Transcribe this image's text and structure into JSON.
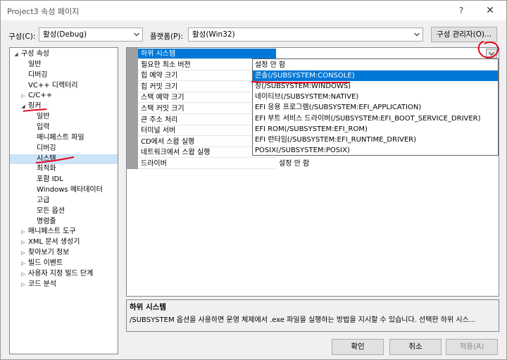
{
  "window": {
    "title": "Project3 속성 페이지",
    "help_glyph": "?",
    "close_glyph": "✕"
  },
  "config": {
    "label": "구성(C):",
    "value": "활성(Debug)"
  },
  "platform": {
    "label": "플랫폼(P):",
    "value": "활성(Win32)"
  },
  "config_manager_label": "구성 관리자(O)...",
  "tree": {
    "items": [
      {
        "label": "구성 속성",
        "level": 0,
        "expander": "◢"
      },
      {
        "label": "일반",
        "level": 1,
        "expander": ""
      },
      {
        "label": "디버깅",
        "level": 1,
        "expander": ""
      },
      {
        "label": "VC++ 디렉터리",
        "level": 1,
        "expander": ""
      },
      {
        "label": "C/C++",
        "level": 1,
        "expander": "▷"
      },
      {
        "label": "링커",
        "level": 1,
        "expander": "◢"
      },
      {
        "label": "일반",
        "level": 2,
        "expander": ""
      },
      {
        "label": "입력",
        "level": 2,
        "expander": ""
      },
      {
        "label": "매니페스트 파일",
        "level": 2,
        "expander": ""
      },
      {
        "label": "디버깅",
        "level": 2,
        "expander": ""
      },
      {
        "label": "시스템",
        "level": 2,
        "expander": "",
        "selected": true
      },
      {
        "label": "최적화",
        "level": 2,
        "expander": ""
      },
      {
        "label": "포함 IDL",
        "level": 2,
        "expander": ""
      },
      {
        "label": "Windows 메타데이터",
        "level": 2,
        "expander": ""
      },
      {
        "label": "고급",
        "level": 2,
        "expander": ""
      },
      {
        "label": "모든 옵션",
        "level": 2,
        "expander": ""
      },
      {
        "label": "명령줄",
        "level": 2,
        "expander": ""
      },
      {
        "label": "매니페스트 도구",
        "level": 1,
        "expander": "▷"
      },
      {
        "label": "XML 문서 생성기",
        "level": 1,
        "expander": "▷"
      },
      {
        "label": "찾아보기 정보",
        "level": 1,
        "expander": "▷"
      },
      {
        "label": "빌드 이벤트",
        "level": 1,
        "expander": "▷"
      },
      {
        "label": "사용자 지정 빌드 단계",
        "level": 1,
        "expander": "▷"
      },
      {
        "label": "코드 분석",
        "level": 1,
        "expander": "▷"
      }
    ]
  },
  "grid": {
    "rows": [
      {
        "name": "하위 시스템",
        "value": "",
        "selected": true
      },
      {
        "name": "필요한 최소 버전",
        "value": ""
      },
      {
        "name": "힙 예약 크기",
        "value": ""
      },
      {
        "name": "힙 커밋 크기",
        "value": ""
      },
      {
        "name": "스택 예약 크기",
        "value": ""
      },
      {
        "name": "스택 커밋 크기",
        "value": ""
      },
      {
        "name": "큰 주소 처리",
        "value": ""
      },
      {
        "name": "터미널 서버",
        "value": ""
      },
      {
        "name": "CD에서 스왑 실행",
        "value": ""
      },
      {
        "name": "네트워크에서 스왑 실행",
        "value": ""
      },
      {
        "name": "드라이버",
        "value": "설정 안 함"
      }
    ]
  },
  "dropdown": {
    "options": [
      {
        "label": "설정 안 함"
      },
      {
        "label": "콘솔(/SUBSYSTEM:CONSOLE)",
        "highlighted": true
      },
      {
        "label": "창(/SUBSYSTEM:WINDOWS)"
      },
      {
        "label": "네이티브(/SUBSYSTEM:NATIVE)"
      },
      {
        "label": "EFI 응용 프로그램(/SUBSYSTEM:EFI_APPLICATION)"
      },
      {
        "label": "EFI 부트 서비스 드라이버(/SUBSYSTEM:EFI_BOOT_SERVICE_DRIVER)"
      },
      {
        "label": "EFI ROM(/SUBSYSTEM:EFI_ROM)"
      },
      {
        "label": "EFI 런타임(/SUBSYSTEM:EFI_RUNTIME_DRIVER)"
      },
      {
        "label": "POSIX(/SUBSYSTEM:POSIX)"
      }
    ]
  },
  "description": {
    "title": "하위 시스템",
    "text": "/SUBSYSTEM 옵션을 사용하면 운영 체제에서 .exe 파일을 실행하는 방법을 지시할 수 있습니다. 선택한 하위 시스..."
  },
  "buttons": {
    "ok": "확인",
    "cancel": "취소",
    "apply": "적용(A)"
  },
  "colors": {
    "selection": "#0078d7",
    "tree_selection": "#cce4f7",
    "annotation": "#e8001c"
  }
}
